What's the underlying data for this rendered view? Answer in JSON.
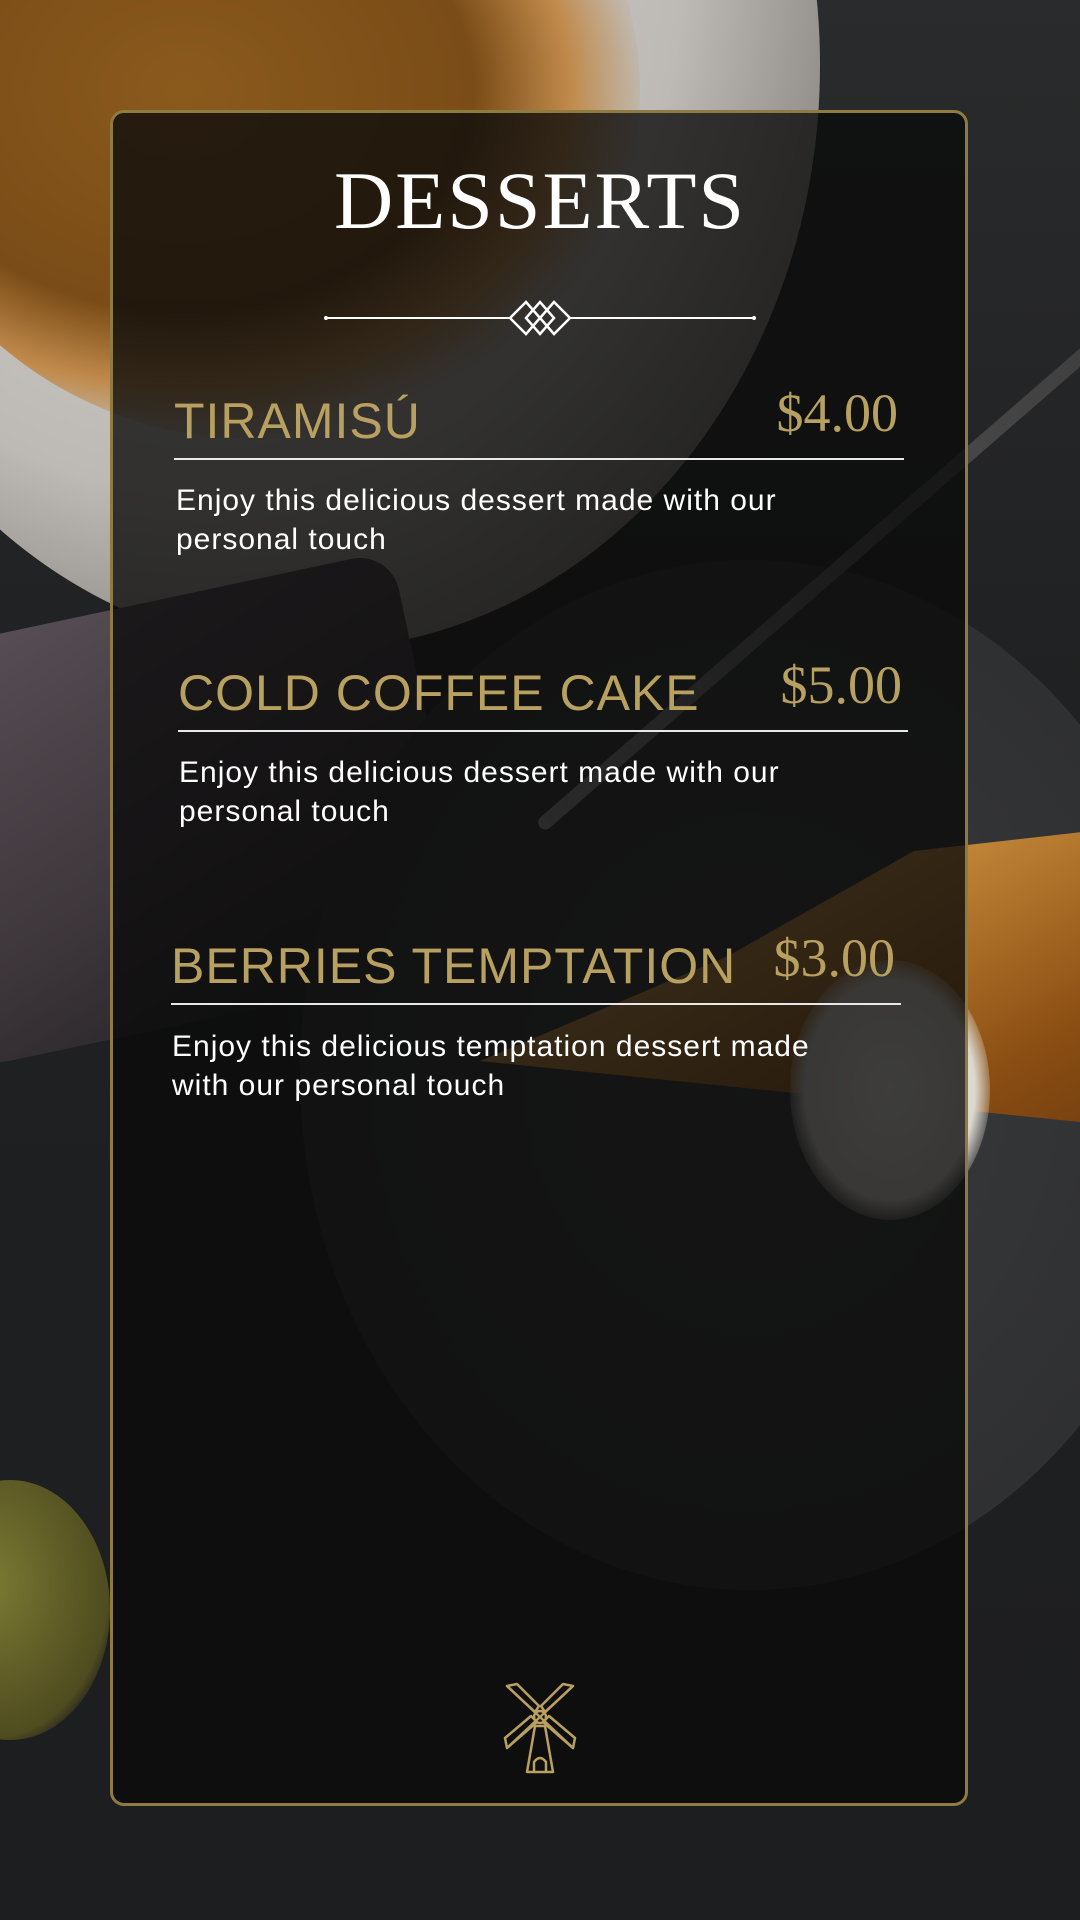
{
  "menu": {
    "title": "DESSERTS",
    "items": [
      {
        "name": "TIRAMISÚ",
        "price": "$4.00",
        "description": "Enjoy this delicious dessert made with our personal touch"
      },
      {
        "name": "COLD COFFEE CAKE",
        "price": "$5.00",
        "description": "Enjoy this delicious dessert made with our personal touch"
      },
      {
        "name": "BERRIES TEMPTATION",
        "price": "$3.00",
        "description": "Enjoy this delicious temptation dessert made with our personal touch"
      }
    ]
  },
  "icons": {
    "divider": "diamond-ornament-icon",
    "logo": "windmill-icon"
  },
  "colors": {
    "gold": "#b8a060",
    "border": "#8e7b42",
    "text": "#ffffff"
  }
}
